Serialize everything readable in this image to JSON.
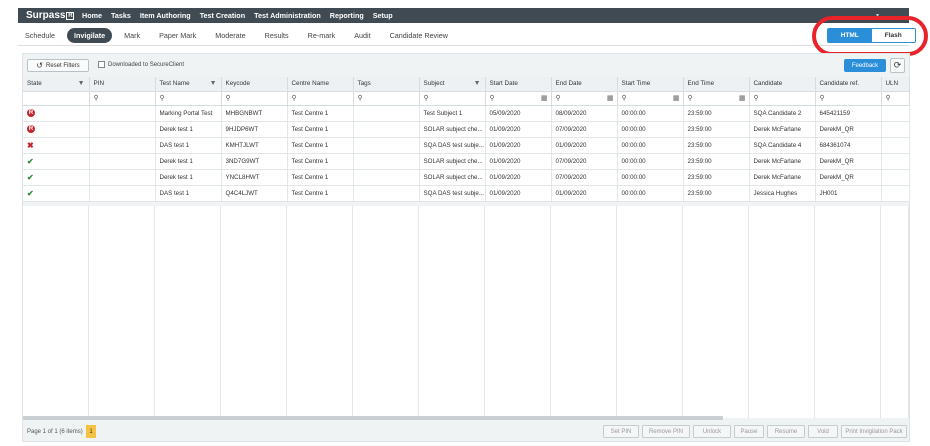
{
  "brand": "Surpass",
  "top_nav": [
    "Home",
    "Tasks",
    "Item Authoring",
    "Test Creation",
    "Test Administration",
    "Reporting",
    "Setup"
  ],
  "sub_nav": [
    "Schedule",
    "Invigilate",
    "Mark",
    "Paper Mark",
    "Moderate",
    "Results",
    "Re-mark",
    "Audit",
    "Candidate Review"
  ],
  "mode_toggle": {
    "html": "HTML",
    "flash": "Flash"
  },
  "toolbar": {
    "reset_filters": "Reset Filters",
    "downloaded_label": "Downloaded to SecureClient",
    "feedback": "Feedback"
  },
  "columns": [
    "State",
    "PIN",
    "Test Name",
    "Keycode",
    "Centre Name",
    "Tags",
    "Subject",
    "Start Date",
    "End Date",
    "Start Time",
    "End Time",
    "Candidate",
    "Candidate ref.",
    "ULN"
  ],
  "rows": [
    {
      "state": "R",
      "pin": "",
      "test": "Marking Portal Test",
      "keycode": "MHBGNBWT",
      "centre": "Test Centre 1",
      "tags": "",
      "subject": "Test Subject 1",
      "start": "05/09/2020",
      "end": "08/09/2020",
      "stime": "00:00:00",
      "etime": "23:59:00",
      "cand": "SQA Candidate 2",
      "ref": "645421159",
      "uln": ""
    },
    {
      "state": "R",
      "pin": "",
      "test": "Derek test 1",
      "keycode": "9HJDP6WT",
      "centre": "Test Centre 1",
      "tags": "",
      "subject": "SOLAR subject che...",
      "start": "01/09/2020",
      "end": "07/09/2020",
      "stime": "00:00:00",
      "etime": "23:59:00",
      "cand": "Derek McFarlane",
      "ref": "DerekM_QR",
      "uln": ""
    },
    {
      "state": "X",
      "pin": "",
      "test": "DAS test 1",
      "keycode": "KMHTJLWT",
      "centre": "Test Centre 1",
      "tags": "",
      "subject": "SQA DAS test subje...",
      "start": "01/09/2020",
      "end": "01/09/2020",
      "stime": "00:00:00",
      "etime": "23:59:00",
      "cand": "SQA Candidate 4",
      "ref": "684361074",
      "uln": ""
    },
    {
      "state": "OK",
      "pin": "",
      "test": "Derek test 1",
      "keycode": "3ND7G9WT",
      "centre": "Test Centre 1",
      "tags": "",
      "subject": "SOLAR subject che...",
      "start": "01/09/2020",
      "end": "07/09/2020",
      "stime": "00:00:00",
      "etime": "23:59:00",
      "cand": "Derek McFarlane",
      "ref": "DerekM_QR",
      "uln": ""
    },
    {
      "state": "OK",
      "pin": "",
      "test": "Derek test 1",
      "keycode": "YNCL8HWT",
      "centre": "Test Centre 1",
      "tags": "",
      "subject": "SOLAR subject che...",
      "start": "01/09/2020",
      "end": "07/09/2020",
      "stime": "00:00:00",
      "etime": "23:59:00",
      "cand": "Derek McFarlane",
      "ref": "DerekM_QR",
      "uln": ""
    },
    {
      "state": "OK",
      "pin": "",
      "test": "DAS test 1",
      "keycode": "Q4C4LJWT",
      "centre": "Test Centre 1",
      "tags": "",
      "subject": "SQA DAS test subje...",
      "start": "01/09/2020",
      "end": "01/09/2020",
      "stime": "00:00:00",
      "etime": "23:59:00",
      "cand": "Jessica Hughes",
      "ref": "JH001",
      "uln": ""
    }
  ],
  "footer": {
    "page_info": "Page 1 of 1 (6 items)",
    "page": "1"
  },
  "actions": [
    "Set PIN",
    "Remove PIN",
    "Unlock",
    "Pause",
    "Resume",
    "Void",
    "Print Invigilation Pack"
  ]
}
